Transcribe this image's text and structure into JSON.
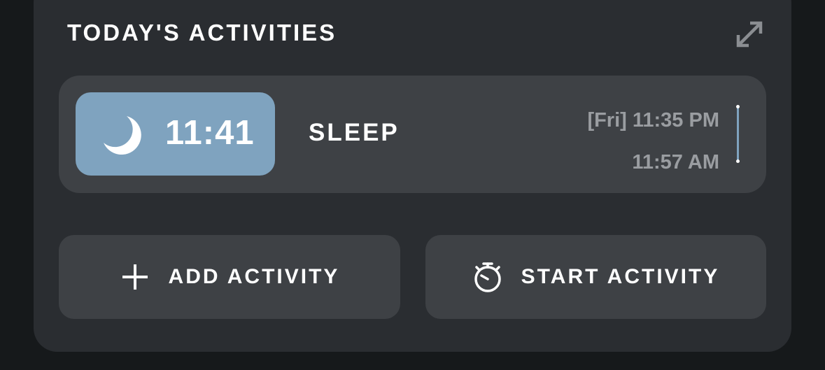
{
  "widget": {
    "title": "TODAY'S ACTIVITIES",
    "expand_icon": "expand-arrows-icon"
  },
  "activity": {
    "icon": "moon-icon",
    "duration": "11:41",
    "name": "SLEEP",
    "start_time": "[Fri] 11:35 PM",
    "end_time": "11:57 AM",
    "accent_color": "#7fa3bf"
  },
  "buttons": {
    "add_icon": "plus-icon",
    "add_label": "ADD ACTIVITY",
    "start_icon": "stopwatch-icon",
    "start_label": "START ACTIVITY"
  }
}
